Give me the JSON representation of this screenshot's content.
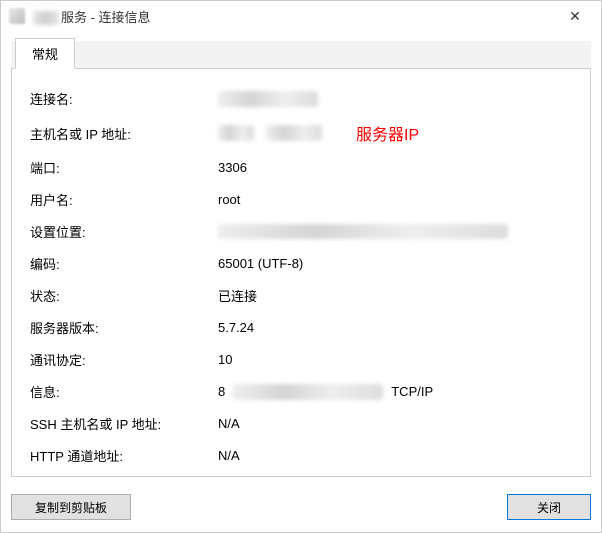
{
  "window": {
    "title_suffix": "服务 - 连接信息",
    "close_label": "✕"
  },
  "tabs": {
    "general": "常规"
  },
  "fields": {
    "conn_name": {
      "label": "连接名:",
      "value": ""
    },
    "host": {
      "label": "主机名或 IP 地址:",
      "value": "",
      "annotation": "服务器IP"
    },
    "port": {
      "label": "端口:",
      "value": "3306"
    },
    "user": {
      "label": "用户名:",
      "value": "root"
    },
    "location": {
      "label": "设置位置:",
      "value": ""
    },
    "encoding": {
      "label": "编码:",
      "value": "65001 (UTF-8)"
    },
    "status": {
      "label": "状态:",
      "value": "已连接"
    },
    "server_ver": {
      "label": "服务器版本:",
      "value": "5.7.24"
    },
    "protocol": {
      "label": "通讯协定:",
      "value": "10"
    },
    "info": {
      "label": "信息:",
      "value_prefix": "8",
      "value_suffix": "TCP/IP"
    },
    "ssh_host": {
      "label": "SSH 主机名或 IP 地址:",
      "value": "N/A"
    },
    "http_tun": {
      "label": "HTTP 通道地址:",
      "value": "N/A"
    }
  },
  "buttons": {
    "copy_clip": "复制到剪贴板",
    "close": "关闭"
  }
}
